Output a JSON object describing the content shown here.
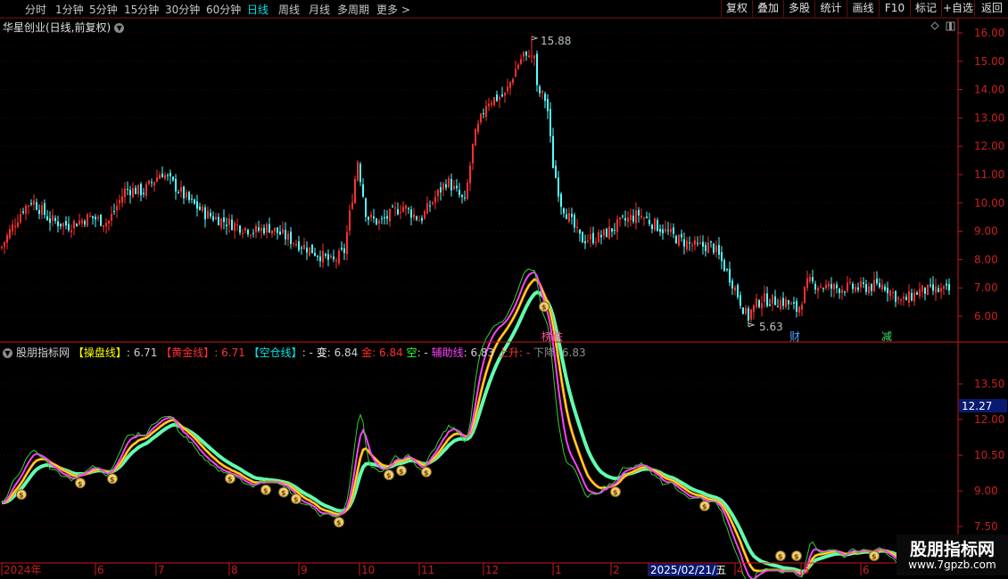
{
  "toolbar": {
    "periods": [
      "分时",
      "1分钟",
      "5分钟",
      "15分钟",
      "30分钟",
      "60分钟",
      "日线",
      "周线",
      "月线",
      "多周期",
      "更多 >"
    ],
    "active_index": 6,
    "buttons": [
      "复权",
      "叠加",
      "多股",
      "统计",
      "画线",
      "F10",
      "标记",
      "+自选",
      "返回"
    ]
  },
  "main_chart": {
    "title": "华星创业(日线,前复权)",
    "y_ticks": [
      "16.00",
      "15.00",
      "14.00",
      "13.00",
      "12.00",
      "11.00",
      "10.00",
      "9.00",
      "8.00",
      "7.00",
      "6.00"
    ],
    "high_label": "15.88",
    "low_label": "5.63",
    "events": [
      {
        "label": "榜跌",
        "color": "#ff50a0"
      },
      {
        "label": "财",
        "color": "#4aa0ff"
      },
      {
        "label": "减",
        "color": "#40e060"
      }
    ]
  },
  "indicator": {
    "name": "股朋指标网",
    "params": [
      {
        "label": "【操盘线】",
        "value": ": 6.71",
        "color": "#ffff00"
      },
      {
        "label": "【黄金线】",
        "value": ": 6.71",
        "color": "#ff3030"
      },
      {
        "label": "【空仓线】",
        "value": ": -",
        "color": "#00e5e5"
      },
      {
        "label": "变",
        "value": ": 6.84",
        "color": "#ffffff"
      },
      {
        "label": "金",
        "value": ": 6.84",
        "color": "#ff3030"
      },
      {
        "label": "空",
        "value": ": -",
        "color": "#30ff30"
      },
      {
        "label": "辅助线",
        "value": ": 6.83",
        "color": "#ff40ff"
      },
      {
        "label": "上升",
        "value": ": -",
        "color": "#ff3030"
      },
      {
        "label": "下降",
        "value": ": 6.83",
        "color": "#909090"
      }
    ],
    "y_ticks": [
      "13.50",
      "12.00",
      "10.50",
      "9.00",
      "7.50"
    ],
    "current_value": "12.27"
  },
  "time_axis": {
    "labels": [
      "2024年",
      "6",
      "7",
      "8",
      "9",
      "10",
      "11",
      "12",
      "1",
      "2",
      "2025/02/21/五",
      "4",
      "5",
      "6"
    ]
  },
  "watermark": {
    "title": "股朋指标网",
    "url": "www.7gpzb.com"
  }
}
